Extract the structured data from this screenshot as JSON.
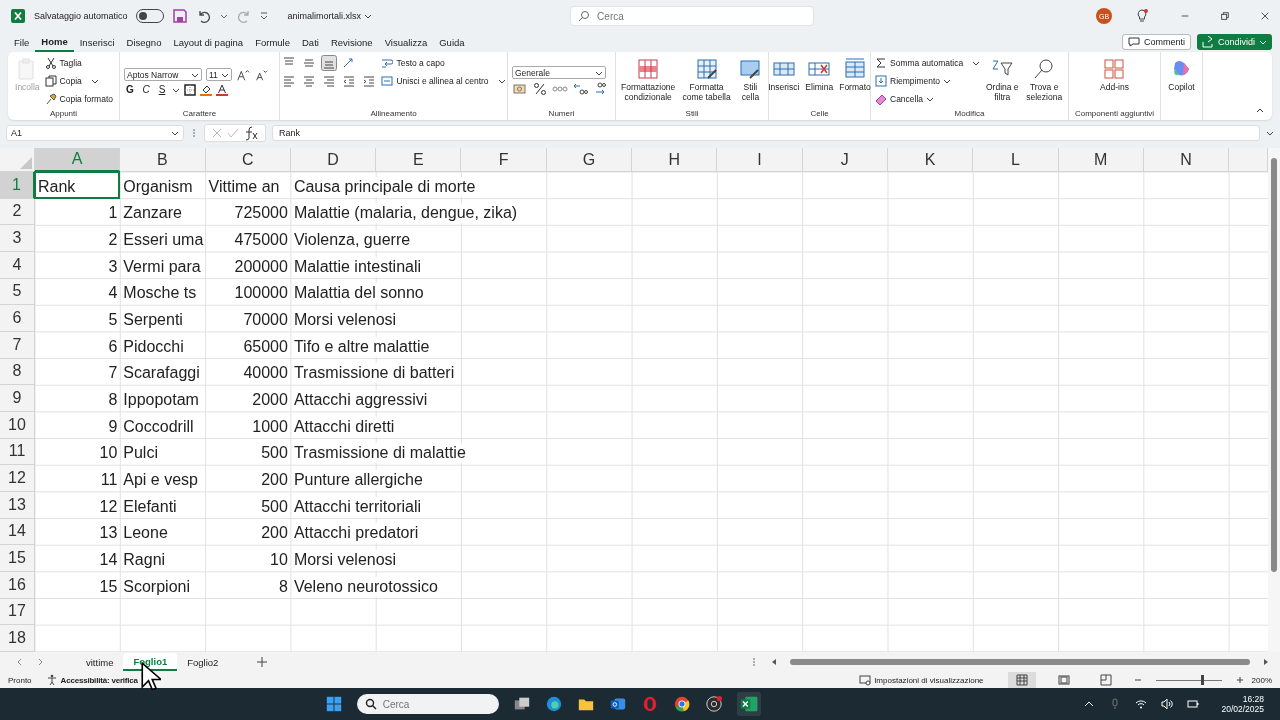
{
  "title_bar": {
    "autosave_label": "Salvataggio automatico",
    "autosave_on": false,
    "file_name": "animalimortali.xlsx",
    "search_placeholder": "Cerca",
    "avatar": "GB"
  },
  "menu_tabs": [
    {
      "label": "File",
      "selected": false
    },
    {
      "label": "Home",
      "selected": true
    },
    {
      "label": "Inserisci",
      "selected": false
    },
    {
      "label": "Disegno",
      "selected": false
    },
    {
      "label": "Layout di pagina",
      "selected": false
    },
    {
      "label": "Formule",
      "selected": false
    },
    {
      "label": "Dati",
      "selected": false
    },
    {
      "label": "Revisione",
      "selected": false
    },
    {
      "label": "Visualizza",
      "selected": false
    },
    {
      "label": "Guida",
      "selected": false
    }
  ],
  "comments_button": "Commenti",
  "share_button": "Condividi",
  "ribbon": {
    "clipboard": {
      "label": "Appunti",
      "paste": {
        "label": "Incolla",
        "disabled": true
      },
      "items": [
        "Taglia",
        "Copia",
        "Copia formato"
      ]
    },
    "font": {
      "label": "Carattere",
      "font_name": "Aptos Narrow",
      "font_size": "11",
      "styles": [
        "G",
        "C",
        "S"
      ]
    },
    "alignment": {
      "label": "Allineamento",
      "wrap": "Testo a capo",
      "merge": "Unisci e allinea al centro"
    },
    "number": {
      "label": "Numeri",
      "format": "Generale"
    },
    "styles": {
      "label": "Stili",
      "items": [
        "Formattazione condizionale",
        "Formatta come tabella",
        "Stili cella"
      ]
    },
    "cells": {
      "label": "Celle",
      "items": [
        "Inserisci",
        "Elimina",
        "Formato"
      ]
    },
    "editing": {
      "label": "Modifica",
      "items": [
        "Somma automatica",
        "Riempimento",
        "Cancella"
      ],
      "big_items": [
        "Ordina e filtra",
        "Trova e seleziona"
      ]
    },
    "addins": {
      "label": "Componenti aggiuntivi",
      "items": [
        "Add-ins"
      ]
    },
    "copilot": "Copilot"
  },
  "formula_bar": {
    "name_box": "A1",
    "formula": "Rank"
  },
  "sheet": {
    "columns": [
      {
        "label": "A",
        "selected": true
      },
      {
        "label": "B",
        "selected": false
      },
      {
        "label": "C",
        "selected": false
      },
      {
        "label": "D",
        "selected": false
      },
      {
        "label": "E",
        "selected": false
      },
      {
        "label": "F",
        "selected": false
      },
      {
        "label": "G",
        "selected": false
      },
      {
        "label": "H",
        "selected": false
      },
      {
        "label": "I",
        "selected": false
      },
      {
        "label": "J",
        "selected": false
      },
      {
        "label": "K",
        "selected": false
      },
      {
        "label": "L",
        "selected": false
      },
      {
        "label": "M",
        "selected": false
      },
      {
        "label": "N",
        "selected": false
      }
    ],
    "rows": [
      {
        "label": "1",
        "selected": true,
        "cells": [
          {
            "text": "Rank",
            "kind": "text"
          },
          {
            "text": "Organism",
            "kind": "text"
          },
          {
            "text": "Vittime an",
            "kind": "text"
          },
          {
            "text": "Causa principale di morte",
            "kind": "text"
          }
        ]
      },
      {
        "label": "2",
        "selected": false,
        "cells": [
          {
            "text": "1",
            "kind": "number"
          },
          {
            "text": "Zanzare",
            "kind": "text"
          },
          {
            "text": "725000",
            "kind": "number"
          },
          {
            "text": "Malattie (malaria, dengue, zika)",
            "kind": "text"
          }
        ]
      },
      {
        "label": "3",
        "selected": false,
        "cells": [
          {
            "text": "2",
            "kind": "number"
          },
          {
            "text": "Esseri uma",
            "kind": "text"
          },
          {
            "text": "475000",
            "kind": "number"
          },
          {
            "text": "Violenza, guerre",
            "kind": "text"
          }
        ]
      },
      {
        "label": "4",
        "selected": false,
        "cells": [
          {
            "text": "3",
            "kind": "number"
          },
          {
            "text": "Vermi para",
            "kind": "text"
          },
          {
            "text": "200000",
            "kind": "number"
          },
          {
            "text": "Malattie intestinali",
            "kind": "text"
          }
        ]
      },
      {
        "label": "5",
        "selected": false,
        "cells": [
          {
            "text": "4",
            "kind": "number"
          },
          {
            "text": "Mosche ts",
            "kind": "text"
          },
          {
            "text": "100000",
            "kind": "number"
          },
          {
            "text": "Malattia del sonno",
            "kind": "text"
          }
        ]
      },
      {
        "label": "6",
        "selected": false,
        "cells": [
          {
            "text": "5",
            "kind": "number"
          },
          {
            "text": "Serpenti",
            "kind": "text"
          },
          {
            "text": "70000",
            "kind": "number"
          },
          {
            "text": "Morsi velenosi",
            "kind": "text"
          }
        ]
      },
      {
        "label": "7",
        "selected": false,
        "cells": [
          {
            "text": "6",
            "kind": "number"
          },
          {
            "text": "Pidocchi",
            "kind": "text"
          },
          {
            "text": "65000",
            "kind": "number"
          },
          {
            "text": "Tifo e altre malattie",
            "kind": "text"
          }
        ]
      },
      {
        "label": "8",
        "selected": false,
        "cells": [
          {
            "text": "7",
            "kind": "number"
          },
          {
            "text": "Scarafaggi",
            "kind": "text"
          },
          {
            "text": "40000",
            "kind": "number"
          },
          {
            "text": "Trasmissione di batteri",
            "kind": "text"
          }
        ]
      },
      {
        "label": "9",
        "selected": false,
        "cells": [
          {
            "text": "8",
            "kind": "number"
          },
          {
            "text": "Ippopotam",
            "kind": "text"
          },
          {
            "text": "2000",
            "kind": "number"
          },
          {
            "text": "Attacchi aggressivi",
            "kind": "text"
          }
        ]
      },
      {
        "label": "10",
        "selected": false,
        "cells": [
          {
            "text": "9",
            "kind": "number"
          },
          {
            "text": "Coccodrill",
            "kind": "text"
          },
          {
            "text": "1000",
            "kind": "number"
          },
          {
            "text": "Attacchi diretti",
            "kind": "text"
          }
        ]
      },
      {
        "label": "11",
        "selected": false,
        "cells": [
          {
            "text": "10",
            "kind": "number"
          },
          {
            "text": "Pulci",
            "kind": "text"
          },
          {
            "text": "500",
            "kind": "number"
          },
          {
            "text": "Trasmissione di malattie",
            "kind": "text"
          }
        ]
      },
      {
        "label": "12",
        "selected": false,
        "cells": [
          {
            "text": "11",
            "kind": "number"
          },
          {
            "text": "Api e vesp",
            "kind": "text"
          },
          {
            "text": "200",
            "kind": "number"
          },
          {
            "text": "Punture allergiche",
            "kind": "text"
          }
        ]
      },
      {
        "label": "13",
        "selected": false,
        "cells": [
          {
            "text": "12",
            "kind": "number"
          },
          {
            "text": "Elefanti",
            "kind": "text"
          },
          {
            "text": "500",
            "kind": "number"
          },
          {
            "text": "Attacchi territoriali",
            "kind": "text"
          }
        ]
      },
      {
        "label": "14",
        "selected": false,
        "cells": [
          {
            "text": "13",
            "kind": "number"
          },
          {
            "text": "Leone",
            "kind": "text"
          },
          {
            "text": "200",
            "kind": "number"
          },
          {
            "text": "Attacchi predatori",
            "kind": "text"
          }
        ]
      },
      {
        "label": "15",
        "selected": false,
        "cells": [
          {
            "text": "14",
            "kind": "number"
          },
          {
            "text": "Ragni",
            "kind": "text"
          },
          {
            "text": "10",
            "kind": "number"
          },
          {
            "text": "Morsi velenosi",
            "kind": "text"
          }
        ]
      },
      {
        "label": "16",
        "selected": false,
        "cells": [
          {
            "text": "15",
            "kind": "number"
          },
          {
            "text": "Scorpioni",
            "kind": "text"
          },
          {
            "text": "8",
            "kind": "number"
          },
          {
            "text": "Veleno neurotossico",
            "kind": "text"
          }
        ]
      },
      {
        "label": "17",
        "selected": false,
        "cells": []
      },
      {
        "label": "18",
        "selected": false,
        "cells": []
      }
    ]
  },
  "sheet_tabs": [
    {
      "label": "vittime",
      "selected": false
    },
    {
      "label": "Foglio1",
      "selected": true
    },
    {
      "label": "Foglio2",
      "selected": false
    }
  ],
  "status_bar": {
    "mode": "Pronto",
    "accessibility": "Accessibilità: verifica",
    "display_settings": "Impostazioni di visualizzazione",
    "zoom": "200%",
    "zoom_slider": {
      "level": 0.7
    }
  },
  "taskbar": {
    "search_placeholder": "Cerca",
    "time": "16:28",
    "date": "20/02/2025"
  }
}
